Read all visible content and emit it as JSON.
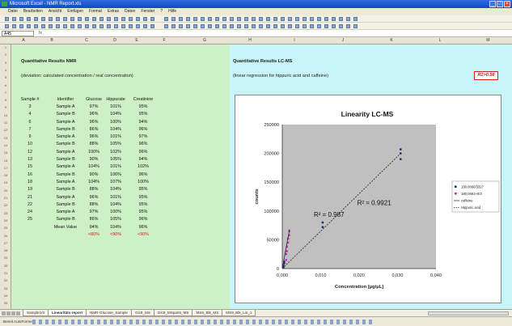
{
  "window": {
    "title": "Microsoft Excel - NMR Report.xls"
  },
  "menu": [
    "Datei",
    "Bearbeiten",
    "Ansicht",
    "Einfügen",
    "Format",
    "Extras",
    "Daten",
    "Fenster",
    "?",
    "Hilfe"
  ],
  "formula": {
    "cell_ref": "A45",
    "fx": "fx"
  },
  "columns": [
    "A",
    "B",
    "C",
    "D",
    "E",
    "F",
    "G",
    "H",
    "I",
    "J",
    "K",
    "L",
    "M"
  ],
  "nmr": {
    "title": "Quantitative Results NMR",
    "subtitle": "(deviation: calculated concentration / real concentration)",
    "headers": [
      "Sample #",
      "Identifier",
      "Glucose",
      "Hippurate",
      "Creatinine"
    ],
    "rows": [
      {
        "num": "3",
        "id": "Sample A",
        "glucose": "97%",
        "hippurate": "101%",
        "creatinine": "95%"
      },
      {
        "num": "4",
        "id": "Sample B",
        "glucose": "96%",
        "hippurate": "104%",
        "creatinine": "95%"
      },
      {
        "num": "6",
        "id": "Sample A",
        "glucose": "96%",
        "hippurate": "100%",
        "creatinine": "94%"
      },
      {
        "num": "7",
        "id": "Sample B",
        "glucose": "86%",
        "hippurate": "104%",
        "creatinine": "96%"
      },
      {
        "num": "9",
        "id": "Sample A",
        "glucose": "96%",
        "hippurate": "101%",
        "creatinine": "97%"
      },
      {
        "num": "10",
        "id": "Sample B",
        "glucose": "88%",
        "hippurate": "105%",
        "creatinine": "96%"
      },
      {
        "num": "12",
        "id": "Sample A",
        "glucose": "100%",
        "hippurate": "102%",
        "creatinine": "96%"
      },
      {
        "num": "13",
        "id": "Sample B",
        "glucose": "90%",
        "hippurate": "105%",
        "creatinine": "94%"
      },
      {
        "num": "15",
        "id": "Sample A",
        "glucose": "104%",
        "hippurate": "101%",
        "creatinine": "102%"
      },
      {
        "num": "16",
        "id": "Sample B",
        "glucose": "90%",
        "hippurate": "106%",
        "creatinine": "96%"
      },
      {
        "num": "18",
        "id": "Sample A",
        "glucose": "104%",
        "hippurate": "107%",
        "creatinine": "100%"
      },
      {
        "num": "19",
        "id": "Sample B",
        "glucose": "88%",
        "hippurate": "104%",
        "creatinine": "95%"
      },
      {
        "num": "21",
        "id": "Sample A",
        "glucose": "96%",
        "hippurate": "101%",
        "creatinine": "95%"
      },
      {
        "num": "22",
        "id": "Sample B",
        "glucose": "88%",
        "hippurate": "104%",
        "creatinine": "95%"
      },
      {
        "num": "24",
        "id": "Sample A",
        "glucose": "97%",
        "hippurate": "100%",
        "creatinine": "95%"
      },
      {
        "num": "25",
        "id": "Sample B",
        "glucose": "86%",
        "hippurate": "105%",
        "creatinine": "96%"
      }
    ],
    "mean": {
      "label": "Mean Value",
      "glucose": "94%",
      "hippurate": "104%",
      "creatinine": "96%"
    },
    "deviation": {
      "glucose": "<80%",
      "hippurate": "<90%",
      "creatinine": "<90%"
    }
  },
  "lcms": {
    "title": "Quantitative Results LC-MS",
    "subtitle": "(linear regression for hippuric acid and caffeine)",
    "r2_badge": "R2>0.98"
  },
  "chart_data": {
    "type": "scatter",
    "title": "Linearity LC-MS",
    "xlabel": "Concentration [µg/µL]",
    "ylabel": "counts",
    "xlim": [
      0,
      0.04
    ],
    "ylim": [
      0,
      250000
    ],
    "xticks": [
      "0,000",
      "0,010",
      "0,020",
      "0,030",
      "0,040"
    ],
    "yticks": [
      "0",
      "50000",
      "100000",
      "150000",
      "200000",
      "250000"
    ],
    "series": [
      {
        "name": "180,0666/3327",
        "color": "#1a237e",
        "marker": "point",
        "x": [
          0.0003,
          0.0003,
          0.0005,
          0.0005,
          0.0105,
          0.0105,
          0.0308,
          0.0308,
          0.0308
        ],
        "y": [
          2000,
          5000,
          9000,
          12000,
          72000,
          80000,
          190000,
          200000,
          207000
        ]
      },
      {
        "name": "180,0661+8/3",
        "color": "#d020d0",
        "marker": "point",
        "x": [
          0.001,
          0.001,
          0.0012,
          0.0012,
          0.0015,
          0.0015,
          0.0018,
          0.0018
        ],
        "y": [
          15000,
          25000,
          30000,
          38000,
          45000,
          52000,
          58000,
          65000
        ]
      },
      {
        "name": "caffeine",
        "color": "#333333",
        "marker": "line",
        "x": [
          0,
          0.0019
        ],
        "y": [
          0,
          68000
        ]
      },
      {
        "name": "Hippuric acid",
        "color": "#333333",
        "marker": "dotted",
        "x": [
          0,
          0.0308
        ],
        "y": [
          0,
          200000
        ]
      }
    ],
    "annotations": [
      {
        "text": "R² = 0.987",
        "x": 0.0082,
        "y": 90000
      },
      {
        "text": "R² = 0.9921",
        "x": 0.0195,
        "y": 110000
      }
    ],
    "legend": "right",
    "grid": false
  },
  "sheets": [
    "Sample1/3",
    "Linearitäts-report",
    "NMR-Glucose_Sample",
    "Glc9_MS",
    "Glc9_MSparts_MS",
    "MS9_Blk_MS",
    "MS9_Blk_Lin_1"
  ],
  "active_sheet": 1,
  "status": "Bereit   AutoFormen"
}
